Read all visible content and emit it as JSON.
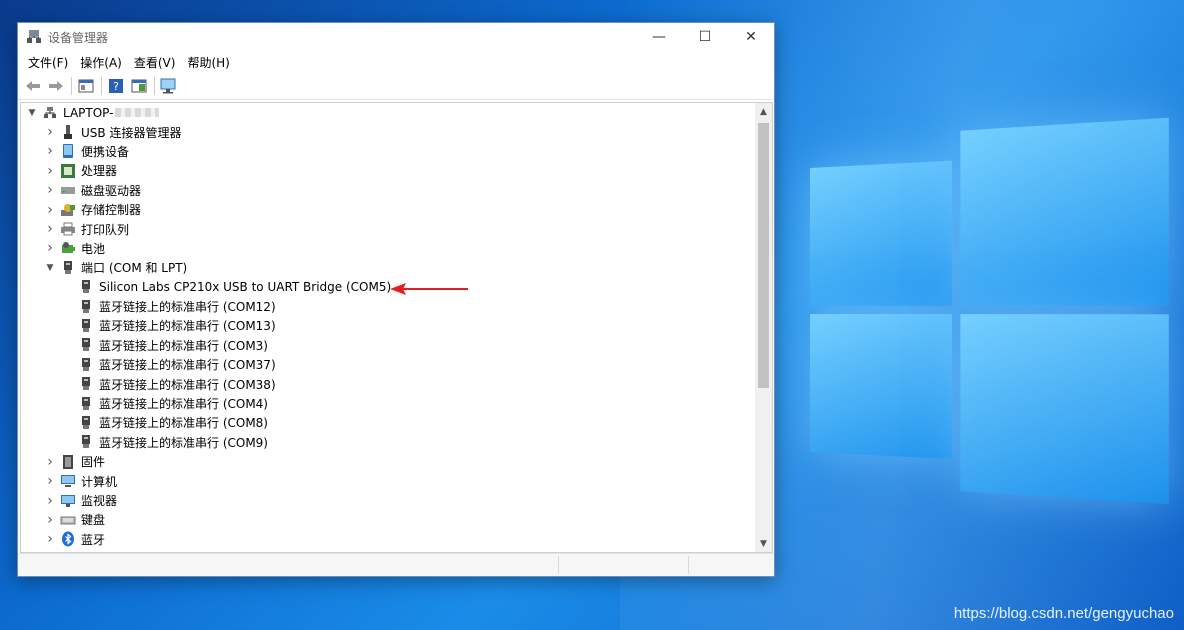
{
  "window": {
    "title": "设备管理器",
    "controls": {
      "minimize": "—",
      "maximize": "☐",
      "close": "✕"
    }
  },
  "menu": [
    "文件(F)",
    "操作(A)",
    "查看(V)",
    "帮助(H)"
  ],
  "tree": {
    "root": "LAPTOP-",
    "items": [
      {
        "label": "USB 连接器管理器",
        "icon": "usb-connector-icon",
        "expanded": false
      },
      {
        "label": "便携设备",
        "icon": "portable-device-icon",
        "expanded": false
      },
      {
        "label": "处理器",
        "icon": "processor-icon",
        "expanded": false
      },
      {
        "label": "磁盘驱动器",
        "icon": "disk-drive-icon",
        "expanded": false
      },
      {
        "label": "存储控制器",
        "icon": "storage-controller-icon",
        "expanded": false
      },
      {
        "label": "打印队列",
        "icon": "printer-icon",
        "expanded": false
      },
      {
        "label": "电池",
        "icon": "battery-icon",
        "expanded": false
      },
      {
        "label": "端口 (COM 和 LPT)",
        "icon": "port-icon",
        "expanded": true
      }
    ],
    "ports": [
      "Silicon Labs CP210x USB to UART Bridge (COM5)",
      "蓝牙链接上的标准串行 (COM12)",
      "蓝牙链接上的标准串行 (COM13)",
      "蓝牙链接上的标准串行 (COM3)",
      "蓝牙链接上的标准串行 (COM37)",
      "蓝牙链接上的标准串行 (COM38)",
      "蓝牙链接上的标准串行 (COM4)",
      "蓝牙链接上的标准串行 (COM8)",
      "蓝牙链接上的标准串行 (COM9)"
    ],
    "after": [
      {
        "label": "固件",
        "icon": "firmware-icon"
      },
      {
        "label": "计算机",
        "icon": "computer-icon"
      },
      {
        "label": "监视器",
        "icon": "monitor-icon"
      },
      {
        "label": "键盘",
        "icon": "keyboard-icon"
      },
      {
        "label": "蓝牙",
        "icon": "bluetooth-icon"
      }
    ]
  },
  "watermark": "https://blog.csdn.net/gengyuchao",
  "colors": {
    "annotation_arrow": "#e02020",
    "desktop_bg": "#0c6bd0"
  }
}
